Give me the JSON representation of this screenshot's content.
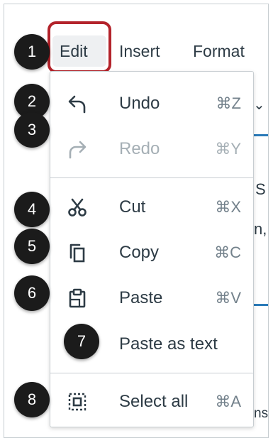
{
  "menubar": {
    "edit": "Edit",
    "insert": "Insert",
    "format": "Format"
  },
  "background": {
    "chevron": "⌄",
    "text_fragments": [
      "S",
      "n,",
      "ns"
    ]
  },
  "menu": {
    "undo": {
      "label": "Undo",
      "shortcut": "⌘Z",
      "icon": "undo-icon"
    },
    "redo": {
      "label": "Redo",
      "shortcut": "⌘Y",
      "icon": "redo-icon",
      "disabled": true
    },
    "cut": {
      "label": "Cut",
      "shortcut": "⌘X",
      "icon": "scissors-icon"
    },
    "copy": {
      "label": "Copy",
      "shortcut": "⌘C",
      "icon": "copy-icon"
    },
    "paste": {
      "label": "Paste",
      "shortcut": "⌘V",
      "icon": "clipboard-icon"
    },
    "paste_text": {
      "label": "Paste as text"
    },
    "select_all": {
      "label": "Select all",
      "shortcut": "⌘A",
      "icon": "select-all-icon"
    }
  },
  "callouts": [
    "1",
    "2",
    "3",
    "4",
    "5",
    "6",
    "7",
    "8"
  ],
  "colors": {
    "highlight": "#b3232b",
    "badge": "#1b1b1b",
    "text": "#2d3b45",
    "disabled": "#a5afb5",
    "accent_line": "#2a7ab8"
  }
}
